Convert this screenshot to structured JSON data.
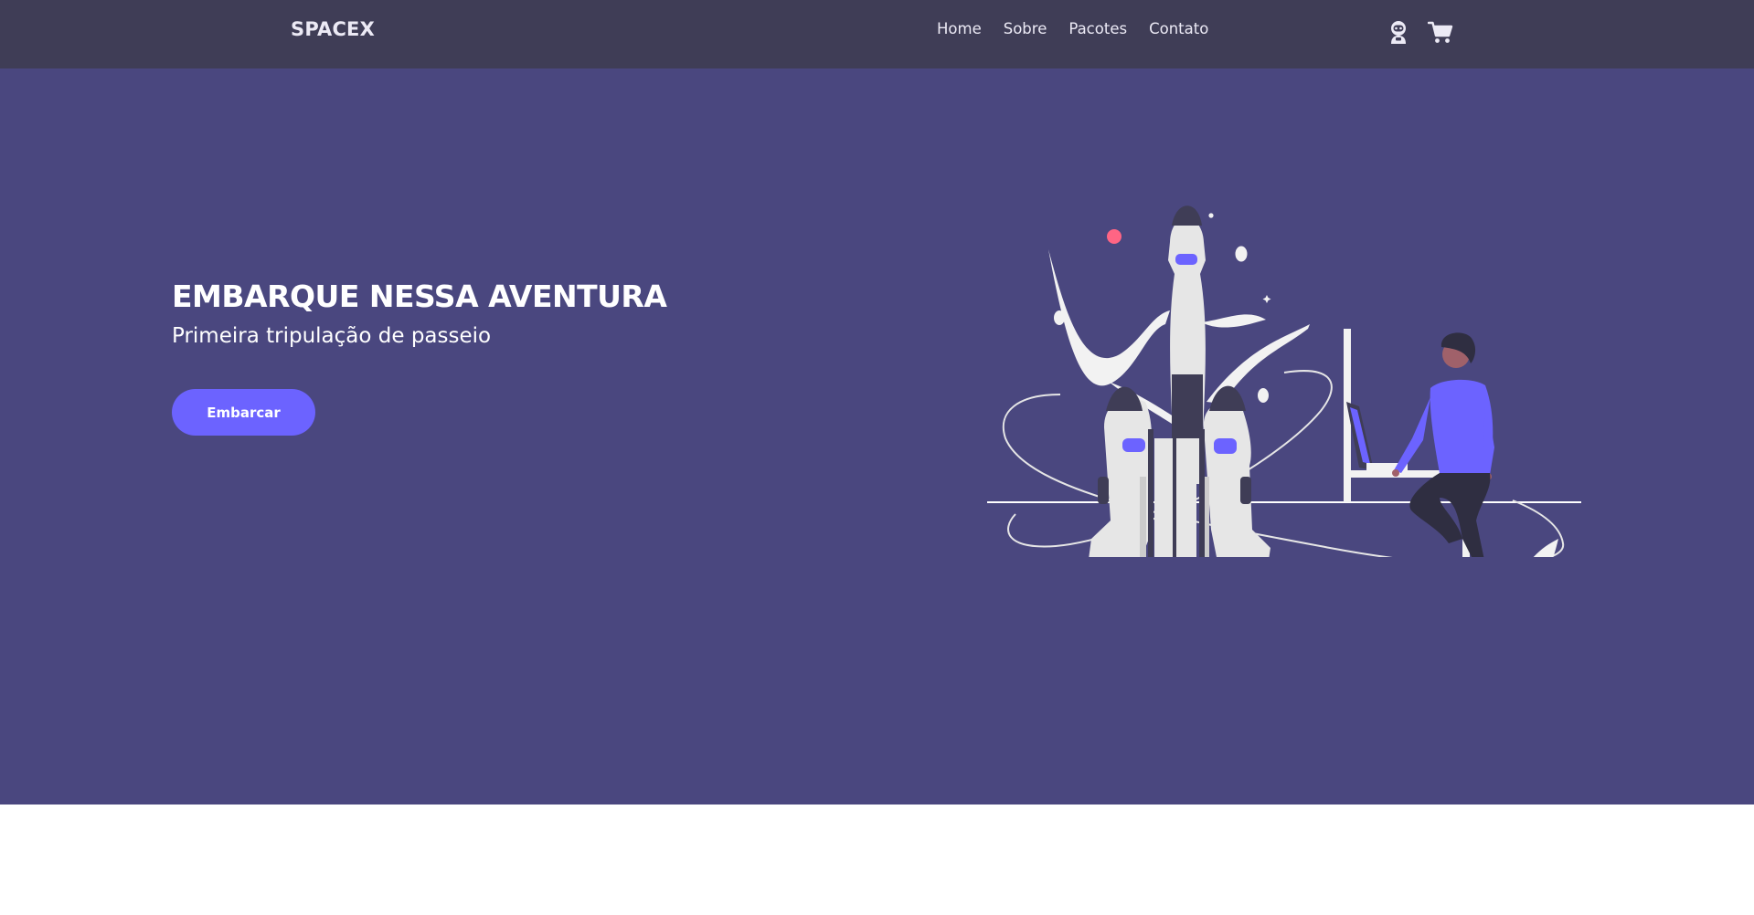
{
  "nav": {
    "logo": "SPACEX",
    "links": [
      "Home",
      "Sobre",
      "Pacotes",
      "Contato"
    ],
    "icons": [
      "astronaut-icon",
      "cart-icon"
    ]
  },
  "hero": {
    "title": "EMBARQUE NESSA AVENTURA",
    "subtitle": "Primeira tripulação de passeio",
    "button_label": "Embarcar"
  },
  "colors": {
    "navbar_bg": "#3f3d56",
    "hero_bg": "#4a477f",
    "accent": "#6c63ff",
    "text_light": "#ffffff"
  }
}
